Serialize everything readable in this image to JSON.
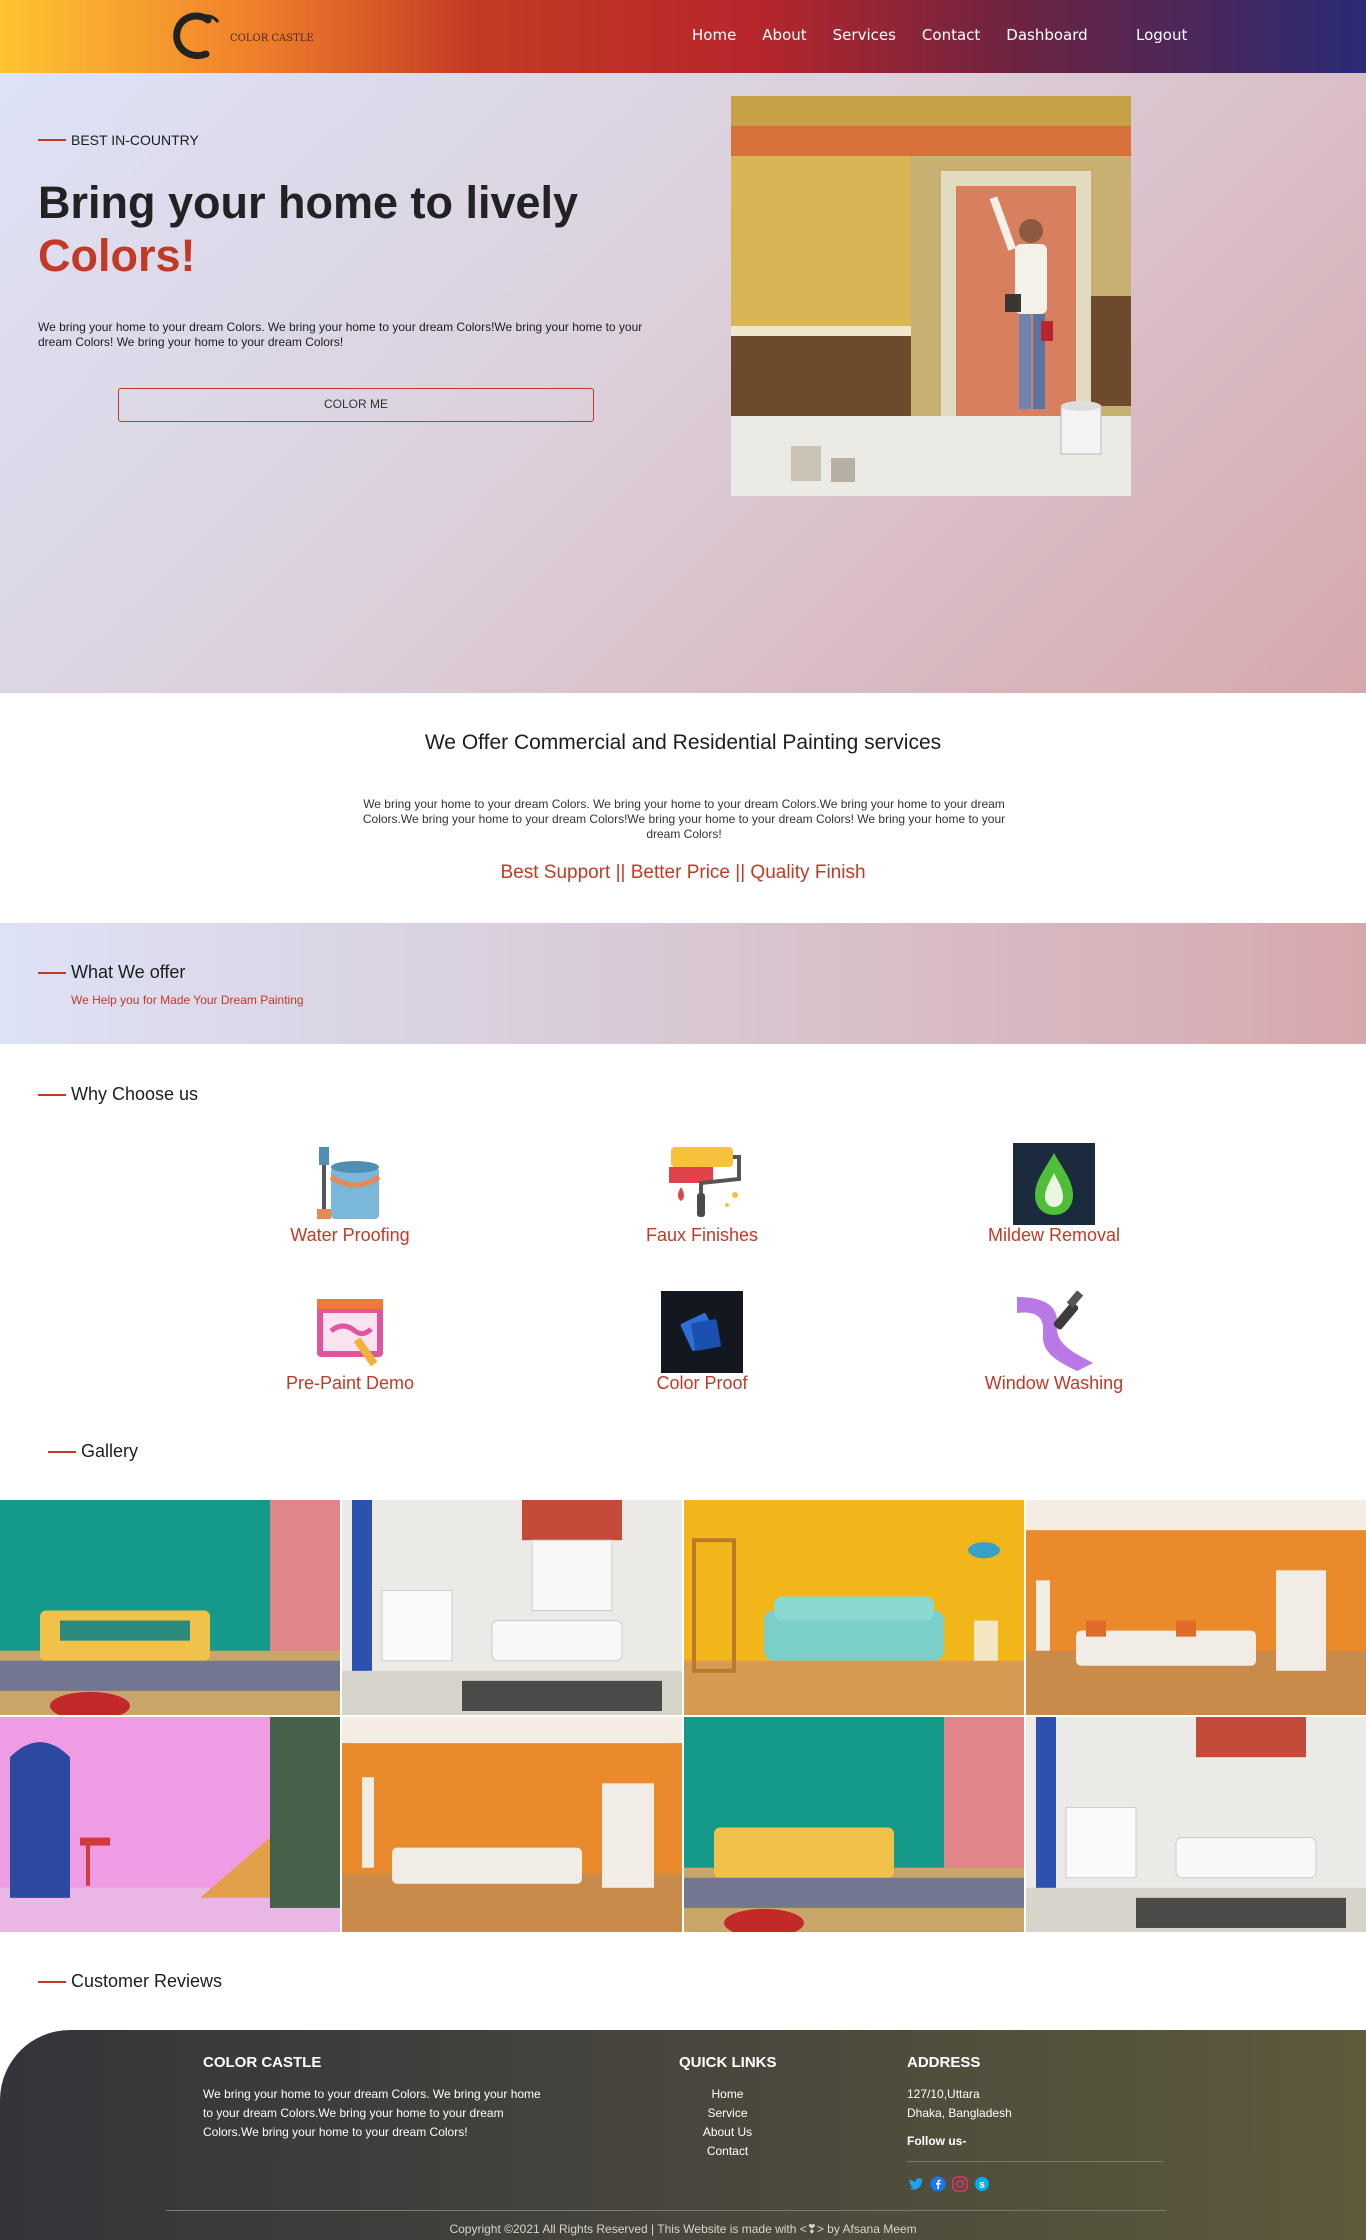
{
  "nav": {
    "brand": "COLOR CASTLE",
    "links": [
      "Home",
      "About",
      "Services",
      "Contact",
      "Dashboard"
    ],
    "logout": "Logout"
  },
  "hero": {
    "eyebrow": "BEST IN-COUNTRY",
    "title_line1": "Bring your home to lively",
    "title_line2": "Colors!",
    "text": "We bring your home to your dream Colors. We bring your home to your dream Colors!We bring your home to your dream Colors! We bring your home to your dream Colors!",
    "button": "COLOR ME"
  },
  "offer": {
    "title": "We Offer Commercial and Residential Painting services",
    "text": "We bring your home to your dream Colors. We bring your home to your dream Colors.We bring your home to your dream Colors.We bring your home to your dream Colors!We bring your home to your dream Colors! We bring your home to your dream Colors!",
    "tagline": "Best Support || Better Price || Quality Finish"
  },
  "what_we_offer": {
    "title": "What We offer",
    "subtitle": "We Help you for Made Your Dream Painting"
  },
  "why_choose": {
    "title": "Why Choose us",
    "features": [
      {
        "label": "Water Proofing",
        "icon": "paint-bucket-icon"
      },
      {
        "label": "Faux Finishes",
        "icon": "paint-roller-icon"
      },
      {
        "label": "Mildew Removal",
        "icon": "drop-icon"
      },
      {
        "label": "Pre-Paint Demo",
        "icon": "paint-screen-icon"
      },
      {
        "label": "Color Proof",
        "icon": "color-swatch-icon"
      },
      {
        "label": "Window Washing",
        "icon": "brush-stroke-icon"
      }
    ]
  },
  "gallery": {
    "title": "Gallery"
  },
  "reviews": {
    "title": "Customer Reviews"
  },
  "footer": {
    "brand_title": "COLOR CASTLE",
    "brand_text": "We bring your home to your dream Colors. We bring your home to your dream Colors.We bring your home to your dream Colors.We bring your home to your dream Colors!",
    "links_title": "QUICK LINKS",
    "links": [
      "Home",
      "Service",
      "About Us",
      "Contact"
    ],
    "address_title": "ADDRESS",
    "address_line1": "127/10,Uttara",
    "address_line2": "Dhaka, Bangladesh",
    "follow": "Follow us-",
    "copyright": "Copyright ©2021 All Rights Reserved | This Website is made with <❣> by Afsana Meem"
  },
  "colors": {
    "accent": "#c23a25"
  }
}
